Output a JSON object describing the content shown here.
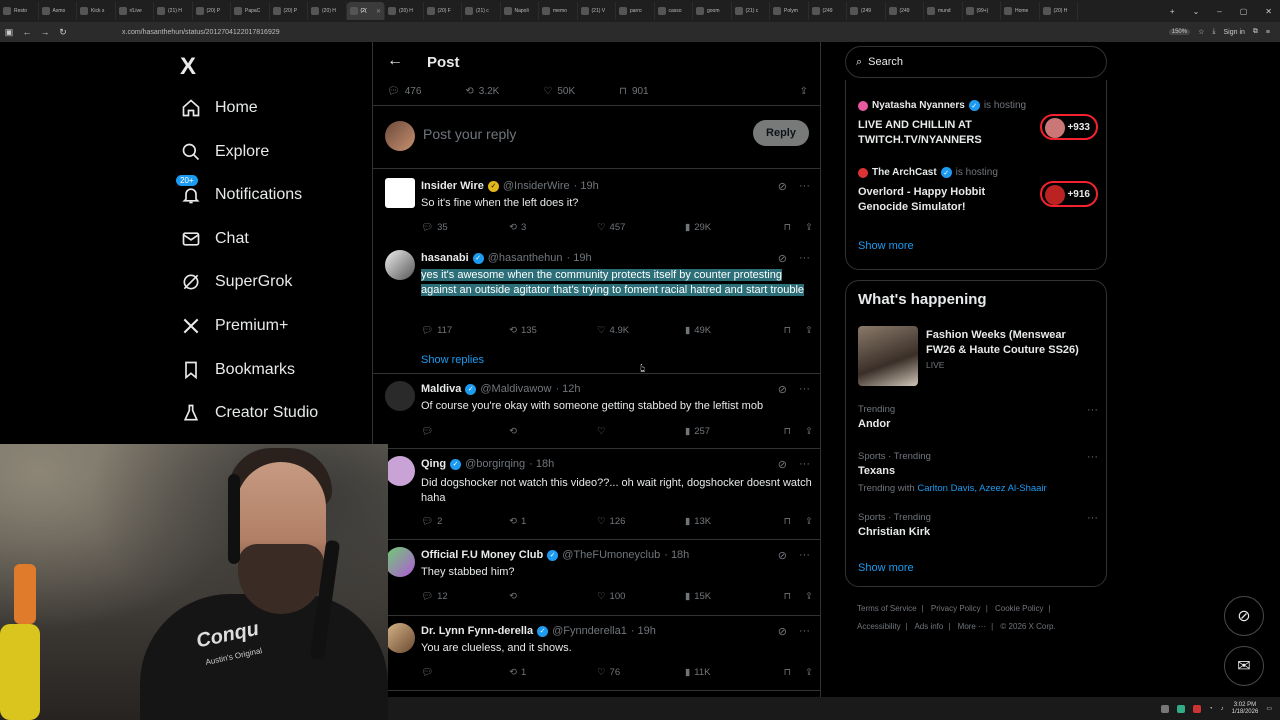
{
  "browser": {
    "tabs": [
      "Resto",
      "Asmo",
      "Kick s",
      "r/Live",
      "(21) H",
      "(20) P",
      "PapaC",
      "(20) P",
      "(20) H",
      "(2(",
      "(20) H",
      "(20) F",
      "(21) c",
      "Napoli",
      "memo",
      "(21) V",
      "parro",
      "casso",
      "goom",
      "(21) c",
      "Polym",
      "(249",
      "(249",
      "(249",
      "mund",
      "(99+)",
      "Home",
      "(20) H"
    ],
    "active_tab_index": 9,
    "url": "x.com/hasanthehun/status/2012704122017816929",
    "zoom": "150%",
    "sign_in": "Sign in"
  },
  "nav": {
    "logo": "X",
    "items": [
      {
        "label": "Home",
        "icon": "home-icon"
      },
      {
        "label": "Explore",
        "icon": "search-icon"
      },
      {
        "label": "Notifications",
        "icon": "bell-icon",
        "badge": "20+"
      },
      {
        "label": "Chat",
        "icon": "mail-icon"
      },
      {
        "label": "SuperGrok",
        "icon": "grok-icon"
      },
      {
        "label": "Premium+",
        "icon": "x-icon"
      },
      {
        "label": "Bookmarks",
        "icon": "bookmark-icon"
      },
      {
        "label": "Creator Studio",
        "icon": "flask-icon"
      }
    ]
  },
  "post": {
    "title": "Post",
    "stats": {
      "replies": "476",
      "reposts": "3.2K",
      "likes": "50K",
      "bookmarks": "901"
    },
    "reply_placeholder": "Post your reply",
    "reply_button": "Reply"
  },
  "tweets": [
    {
      "name": "Insider Wire",
      "badge": "gold",
      "handle": "@InsiderWire",
      "time": "· 19h",
      "text": "So it's fine when the left does it?",
      "replies": "35",
      "reposts": "3",
      "likes": "457",
      "views": "29K"
    },
    {
      "name": "hasanabi",
      "badge": "blue",
      "handle": "@hasanthehun",
      "time": "· 19h",
      "text": "yes it's awesome when the community protects itself by counter protesting against an outside agitator that's trying to foment racial hatred and start trouble",
      "replies": "117",
      "reposts": "135",
      "likes": "4.9K",
      "views": "49K",
      "show_replies": "Show replies"
    },
    {
      "name": "Maldiva",
      "badge": "blue",
      "handle": "@Maldivawow",
      "time": "· 12h",
      "text": "Of course you're okay with someone getting stabbed by the leftist mob",
      "replies": "",
      "reposts": "",
      "likes": "",
      "views": "257"
    },
    {
      "name": "Qing",
      "badge": "blue",
      "handle": "@borgirqing",
      "time": "· 18h",
      "text": "Did dogshocker not watch this video??... oh wait right, dogshocker doesnt watch haha",
      "replies": "2",
      "reposts": "1",
      "likes": "126",
      "views": "13K"
    },
    {
      "name": "Official F.U Money Club",
      "badge": "blue",
      "handle": "@TheFUmoneyclub",
      "time": "· 18h",
      "text": "They stabbed him?",
      "replies": "12",
      "reposts": "",
      "likes": "100",
      "views": "15K"
    },
    {
      "name": "Dr. Lynn Fynn-derella",
      "badge": "blue",
      "handle": "@Fynnderella1",
      "time": "· 19h",
      "text": "You are clueless, and it shows.",
      "replies": "",
      "reposts": "1",
      "likes": "76",
      "views": "11K"
    }
  ],
  "sidebar": {
    "search_placeholder": "Search",
    "live": [
      {
        "host": "Nyatasha Nyanners",
        "hosting": "is hosting",
        "title": "LIVE AND CHILLIN AT TWITCH.TV/NYANNERS",
        "count": "+933"
      },
      {
        "host": "The ArchCast",
        "hosting": "is hosting",
        "title": "Overlord - Happy Hobbit Genocide Simulator!",
        "count": "+916"
      }
    ],
    "show_more": "Show more",
    "happening": {
      "title": "What's happening",
      "feature": {
        "title": "Fashion Weeks (Menswear FW26 & Haute Couture SS26)",
        "tag": "LIVE"
      },
      "trends": [
        {
          "meta": "Trending",
          "name": "Andor"
        },
        {
          "meta": "Sports · Trending",
          "name": "Texans",
          "with_label": "Trending with",
          "with": "Carlton Davis, Azeez Al-Shaair"
        },
        {
          "meta": "Sports · Trending",
          "name": "Christian Kirk"
        }
      ],
      "show_more": "Show more"
    },
    "footer": {
      "links": [
        "Terms of Service",
        "Privacy Policy",
        "Cookie Policy",
        "Accessibility",
        "Ads info",
        "More ···"
      ],
      "copyright": "© 2026 X Corp."
    }
  },
  "webcam": {
    "shirt_text": "Conqu",
    "shirt_sub": "Austin's Original"
  },
  "taskbar": {
    "time": "3:02 PM",
    "date": "1/18/2026"
  }
}
